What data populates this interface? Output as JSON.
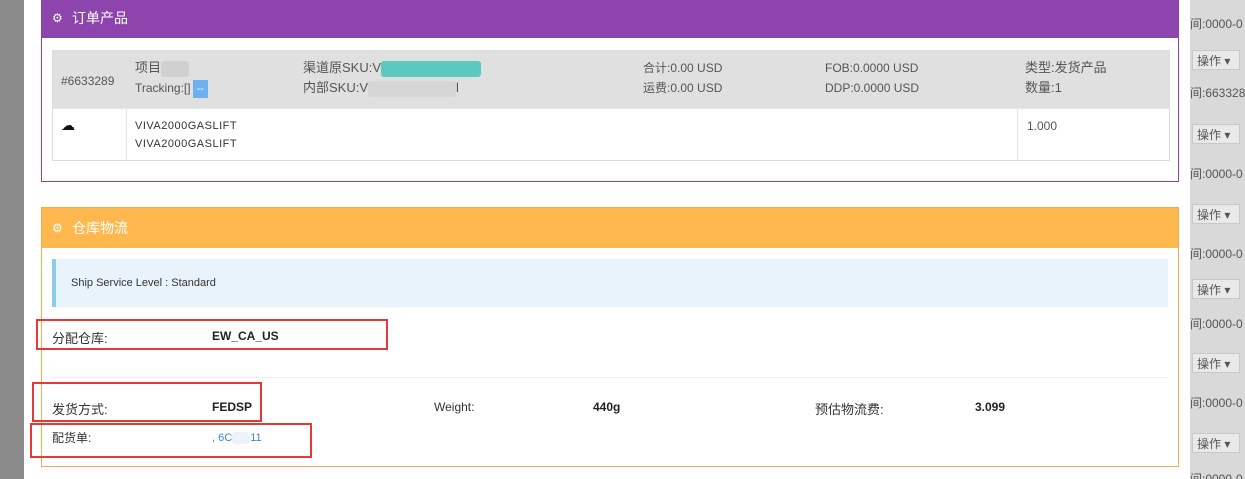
{
  "order_panel": {
    "title": "订单产品",
    "order_no": "#6633289",
    "item_label": "项目",
    "tracking_label": "Tracking:[]",
    "tracking_btn": "--",
    "source_sku_label": "渠道原SKU:",
    "source_sku_prefix": "V",
    "internal_sku_label": "内部SKU:",
    "internal_sku_prefix": "V",
    "internal_sku_suffix": "l",
    "total": "合计:0.00 USD",
    "shipping_fee": "运费:0.00 USD",
    "fob": "FOB:0.0000 USD",
    "ddp": "DDP:0.0000 USD",
    "type": "类型:发货产品",
    "quantity": "数量:1",
    "line_item": {
      "name1": "VIVA2000GASLIFT",
      "name2": "VIVA2000GASLIFT",
      "qty": "1.000"
    }
  },
  "warehouse_panel": {
    "title": "仓库物流",
    "ship_service": "Ship Service Level : Standard",
    "warehouse_label": "分配仓库:",
    "warehouse_value": "EW_CA_US",
    "method_label": "发货方式:",
    "method_value": "FEDSP",
    "weight_label": "Weight:",
    "weight_value": "440g",
    "est_fee_label": "预估物流费:",
    "est_fee_value": "3.099",
    "picklist_label": "配货单:",
    "picklist_value": ", 6C",
    "picklist_suffix": "11"
  },
  "background_list": {
    "time_label": "间:0000-0",
    "op_label": "操作 ▾"
  },
  "colors": {
    "purple": "#8e44ad",
    "orange": "#ffb84d",
    "red_highlight": "#e53935",
    "link": "#3a87c8"
  }
}
